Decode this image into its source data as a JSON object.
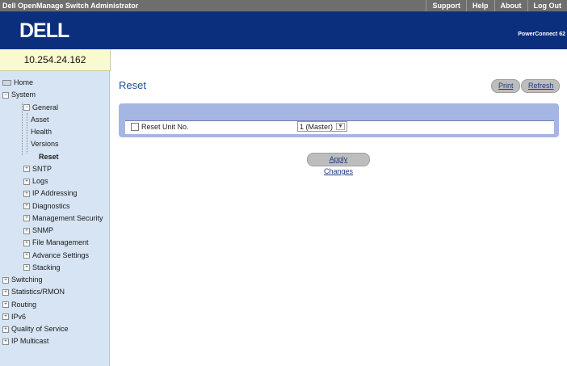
{
  "header": {
    "app_title": "Dell OpenManage Switch Administrator",
    "links": [
      "Support",
      "Help",
      "About",
      "Log Out"
    ],
    "logo": "DELL",
    "product": "PowerConnect 62"
  },
  "ip_address": "10.254.24.162",
  "nav": [
    {
      "label": "Home",
      "level": 0,
      "icon": "home-icon"
    },
    {
      "label": "System",
      "level": 0,
      "icon": "minus-icon"
    },
    {
      "label": "General",
      "level": 1,
      "icon": "minus-icon"
    },
    {
      "label": "Asset",
      "level": 2
    },
    {
      "label": "Health",
      "level": 2
    },
    {
      "label": "Versions",
      "level": 2
    },
    {
      "label": "Reset",
      "level": 2,
      "selected": true
    },
    {
      "label": "SNTP",
      "level": 1,
      "icon": "plus-icon"
    },
    {
      "label": "Logs",
      "level": 1,
      "icon": "plus-icon"
    },
    {
      "label": "IP Addressing",
      "level": 1,
      "icon": "plus-icon"
    },
    {
      "label": "Diagnostics",
      "level": 1,
      "icon": "plus-icon"
    },
    {
      "label": "Management Security",
      "level": 1,
      "icon": "plus-icon"
    },
    {
      "label": "SNMP",
      "level": 1,
      "icon": "plus-icon"
    },
    {
      "label": "File Management",
      "level": 1,
      "icon": "plus-icon"
    },
    {
      "label": "Advance Settings",
      "level": 1,
      "icon": "plus-icon"
    },
    {
      "label": "Stacking",
      "level": 1,
      "icon": "plus-icon"
    },
    {
      "label": "Switching",
      "level": 0,
      "icon": "plus-icon"
    },
    {
      "label": "Statistics/RMON",
      "level": 0,
      "icon": "plus-icon"
    },
    {
      "label": "Routing",
      "level": 0,
      "icon": "plus-icon"
    },
    {
      "label": "IPv6",
      "level": 0,
      "icon": "plus-icon"
    },
    {
      "label": "Quality of Service",
      "level": 0,
      "icon": "plus-icon"
    },
    {
      "label": "IP Multicast",
      "level": 0,
      "icon": "plus-icon"
    }
  ],
  "main": {
    "title": "Reset",
    "print_label": "Print",
    "refresh_label": "Refresh",
    "reset_unit_label": "Reset Unit No.",
    "reset_unit_value": "1 (Master)",
    "apply_label": "Apply Changes"
  },
  "colors": {
    "banner": "#0b2f7c",
    "sidebar": "#d6e4f3",
    "panel": "#a6b6e3",
    "title": "#1a4f9c"
  }
}
